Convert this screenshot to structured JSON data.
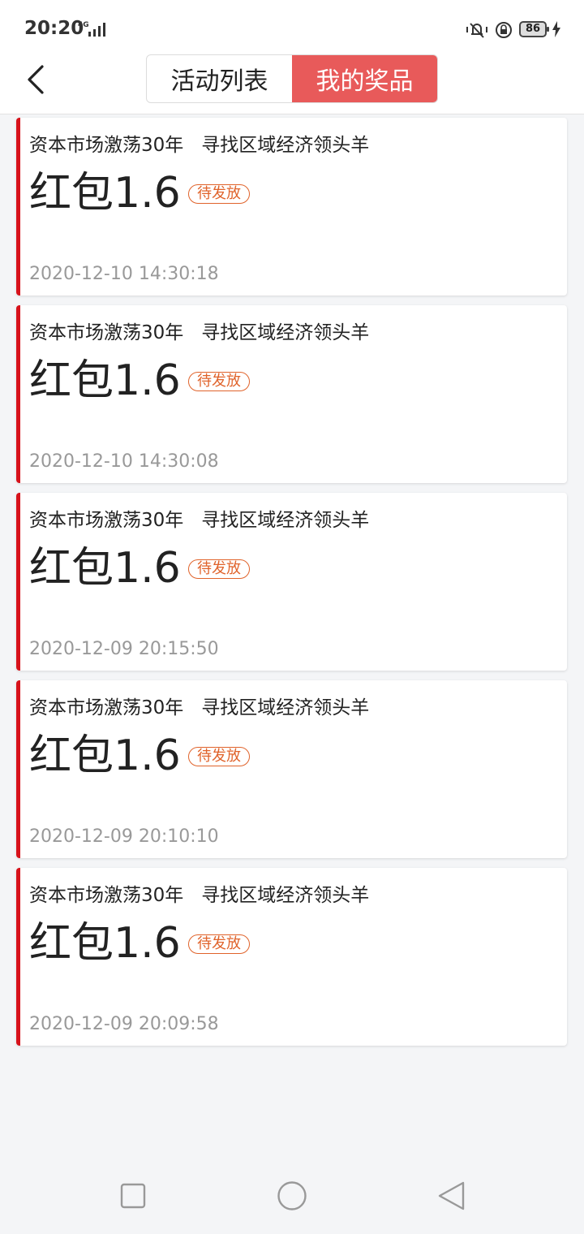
{
  "status_bar": {
    "time": "20:20",
    "network": "4G",
    "battery": "86",
    "icons": [
      "signal-icon",
      "silent-icon",
      "rotate-lock-icon",
      "battery-icon",
      "charge-icon"
    ]
  },
  "header": {
    "back_icon": "chevron-left-icon",
    "tabs": [
      {
        "label": "活动列表",
        "active": false
      },
      {
        "label": "我的奖品",
        "active": true
      }
    ]
  },
  "prizes": [
    {
      "title": "资本市场激荡30年   寻找区域经济领头羊",
      "name": "红包1.6",
      "status": "待发放",
      "time": "2020-12-10 14:30:18"
    },
    {
      "title": "资本市场激荡30年   寻找区域经济领头羊",
      "name": "红包1.6",
      "status": "待发放",
      "time": "2020-12-10 14:30:08"
    },
    {
      "title": "资本市场激荡30年   寻找区域经济领头羊",
      "name": "红包1.6",
      "status": "待发放",
      "time": "2020-12-09 20:15:50"
    },
    {
      "title": "资本市场激荡30年   寻找区域经济领头羊",
      "name": "红包1.6",
      "status": "待发放",
      "time": "2020-12-09 20:10:10"
    },
    {
      "title": "资本市场激荡30年   寻找区域经济领头羊",
      "name": "红包1.6",
      "status": "待发放",
      "time": "2020-12-09 20:09:58"
    }
  ],
  "nav": {
    "icons": [
      "recent-apps-icon",
      "home-icon",
      "back-icon"
    ]
  },
  "colors": {
    "accent": "#e85a5a",
    "card_border": "#d7121b",
    "badge": "#e0632b",
    "time_text": "#999999",
    "background": "#f4f5f7"
  }
}
